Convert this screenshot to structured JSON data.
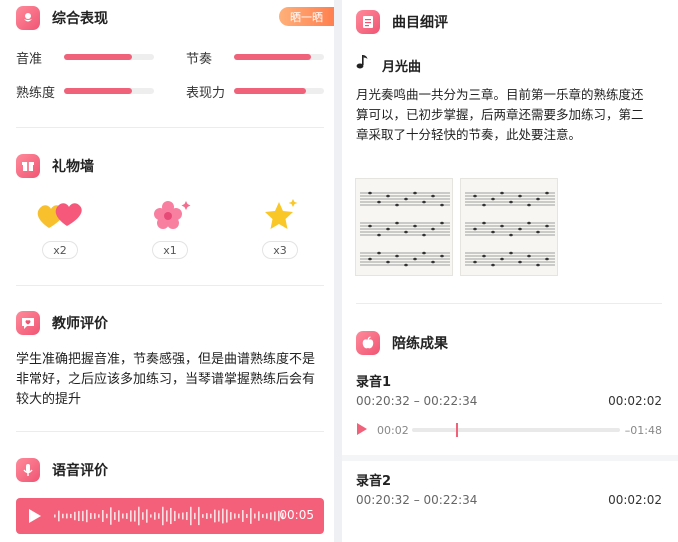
{
  "left": {
    "performance": {
      "title": "综合表现",
      "share_label": "晒一晒",
      "stats": [
        {
          "label": "音准",
          "value": 0.75
        },
        {
          "label": "节奏",
          "value": 0.85
        },
        {
          "label": "熟练度",
          "value": 0.75
        },
        {
          "label": "表现力",
          "value": 0.8
        }
      ]
    },
    "gifts": {
      "title": "礼物墙",
      "items": [
        {
          "icon": "hearts-icon",
          "count": "x2"
        },
        {
          "icon": "flower-icon",
          "count": "x1"
        },
        {
          "icon": "stars-icon",
          "count": "x3"
        }
      ]
    },
    "teacher": {
      "title": "教师评价",
      "text_lines": [
        "学生准确把握音准，节奏感强，但是曲谱熟练度不是",
        "非常好，之后应该多加练习，当琴谱掌握熟练后会有",
        "较大的提升"
      ]
    },
    "voice": {
      "title": "语音评价",
      "time": "00:05"
    }
  },
  "right": {
    "review": {
      "title": "曲目细评",
      "song": "月光曲",
      "text_lines": [
        "月光奏鸣曲一共分为三章。目前第一乐章的熟练度还",
        "算可以，已初步掌握，后两章还需要多加练习，第二",
        "章采取了十分轻快的节奏，此处要注意。"
      ]
    },
    "results": {
      "title": "陪练成果",
      "recordings": [
        {
          "title": "录音1",
          "range": "00:20:32 – 00:22:34",
          "duration": "00:02:02",
          "elapsed": "00:02",
          "remaining": "–01:48",
          "progress": 0.21
        },
        {
          "title": "录音2",
          "range": "00:20:32 – 00:22:34",
          "duration": "00:02:02"
        }
      ]
    }
  },
  "colors": {
    "accent": "#f0627a",
    "share": "#ff8f5a"
  }
}
